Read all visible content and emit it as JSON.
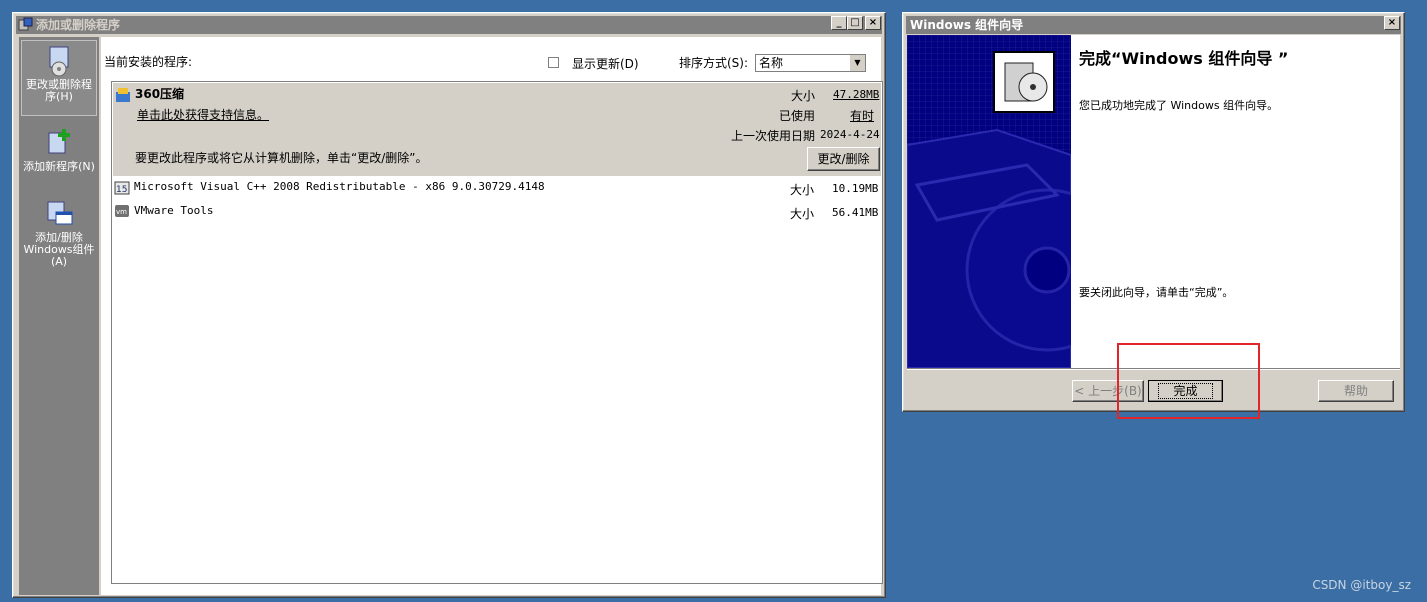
{
  "arp_window": {
    "title": "添加或删除程序",
    "controls": {
      "minimize": "_",
      "maximize": "□",
      "close": "×"
    },
    "sidebar": [
      {
        "label": "更改或删除程序(H)",
        "icon": "change-remove-programs-icon",
        "active": true
      },
      {
        "label": "添加新程序(N)",
        "icon": "add-new-programs-icon",
        "active": false
      },
      {
        "label": "添加/删除Windows组件(A)",
        "icon": "windows-components-icon",
        "active": false
      }
    ],
    "installed_label": "当前安装的程序:",
    "show_updates_label": "显示更新(D)",
    "sort_label": "排序方式(S):",
    "sort_value": "名称",
    "selected_program": {
      "name": "360压缩",
      "support_link": "单击此处获得支持信息。",
      "size_label": "大小",
      "size_value": "47.28MB",
      "used_label": "已使用",
      "used_value": "有时",
      "last_used_label": "上一次使用日期",
      "last_used_value": "2024-4-24",
      "hint": "要更改此程序或将它从计算机删除，单击“更改/删除”。",
      "change_button": "更改/删除"
    },
    "programs": [
      {
        "name": "Microsoft Visual C++ 2008 Redistributable - x86 9.0.30729.4148",
        "size_label": "大小",
        "size_value": "10.19MB",
        "icon": "vcpp-icon"
      },
      {
        "name": "VMware Tools",
        "size_label": "大小",
        "size_value": "56.41MB",
        "icon": "vmware-icon"
      }
    ]
  },
  "wizard_window": {
    "title": "Windows 组件向导",
    "close": "×",
    "heading": "完成“Windows 组件向导 ”",
    "message": "您已成功地完成了 Windows 组件向导。",
    "close_hint": "要关闭此向导，请单击“完成”。",
    "back_button": "< 上一步(B)",
    "finish_button": "完成",
    "help_button": "帮助"
  },
  "watermark": "CSDN @itboy_sz",
  "colors": {
    "desktop": "#3a6ea5",
    "wizard_banner": "#000080",
    "highlight": "#e0262b"
  }
}
